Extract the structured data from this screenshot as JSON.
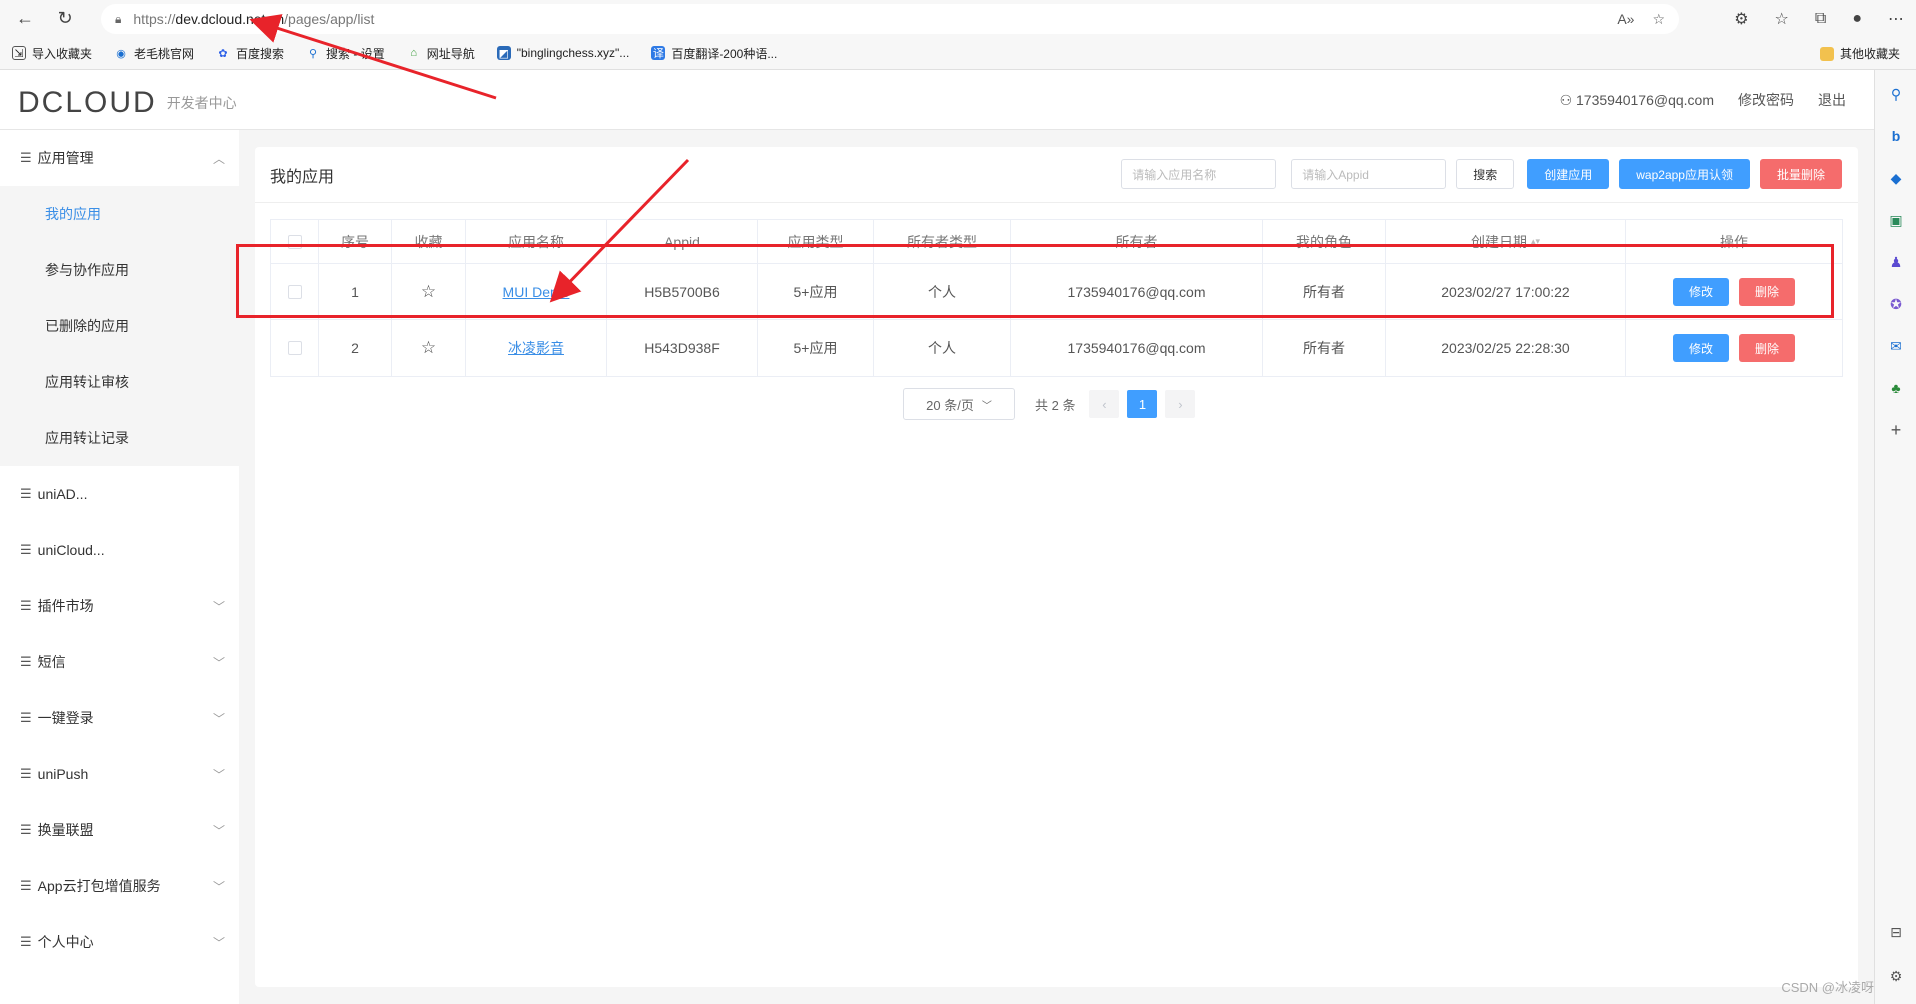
{
  "browser": {
    "url_scheme": "https://",
    "url_host": "dev.dcloud.net.cn",
    "url_path": "/pages/app/list",
    "bookmarks": [
      {
        "label": "导入收藏夹"
      },
      {
        "label": "老毛桃官网"
      },
      {
        "label": "百度搜索"
      },
      {
        "label": "搜索 - 设置"
      },
      {
        "label": "网址导航"
      },
      {
        "label": "\"binglingchess.xyz\"..."
      },
      {
        "label": "百度翻译-200种语..."
      }
    ],
    "other_bookmarks": "其他收藏夹"
  },
  "header": {
    "logo": "DCLOUD",
    "logo_sub": "开发者中心",
    "user": "1735940176@qq.com",
    "change_password": "修改密码",
    "logout": "退出"
  },
  "sidebar": {
    "app_mgmt": "应用管理",
    "sub_items": [
      "我的应用",
      "参与协作应用",
      "已删除的应用",
      "应用转让审核",
      "应用转让记录"
    ],
    "items": [
      "uniAD...",
      "uniCloud...",
      "插件市场",
      "短信",
      "一键登录",
      "uniPush",
      "换量联盟",
      "App云打包增值服务",
      "个人中心"
    ]
  },
  "main": {
    "title": "我的应用",
    "search_name_placeholder": "请输入应用名称",
    "search_appid_placeholder": "请输入Appid",
    "search_btn": "搜索",
    "create_btn": "创建应用",
    "wap2app_btn": "wap2app应用认领",
    "batch_delete_btn": "批量删除"
  },
  "table": {
    "headers": [
      "序号",
      "收藏",
      "应用名称",
      "Appid",
      "应用类型",
      "所有者类型",
      "所有者",
      "我的角色",
      "创建日期",
      "操作"
    ],
    "rows": [
      {
        "no": "1",
        "name": "MUI Demo",
        "appid": "H5B5700B6",
        "type": "5+应用",
        "owner_type": "个人",
        "owner": "1735940176@qq.com",
        "role": "所有者",
        "date": "2023/02/27 17:00:22"
      },
      {
        "no": "2",
        "name": "冰凌影音",
        "appid": "H543D938F",
        "type": "5+应用",
        "owner_type": "个人",
        "owner": "1735940176@qq.com",
        "role": "所有者",
        "date": "2023/02/25 22:28:30"
      }
    ],
    "edit": "修改",
    "delete": "删除"
  },
  "pager": {
    "page_size": "20 条/页",
    "total": "共 2 条",
    "current": "1"
  },
  "watermark": "CSDN @冰凌呀",
  "colors": {
    "primary": "#409eff",
    "danger": "#f56c6c",
    "annotation": "#e8232a",
    "logo_accent": "#f07a2a"
  }
}
